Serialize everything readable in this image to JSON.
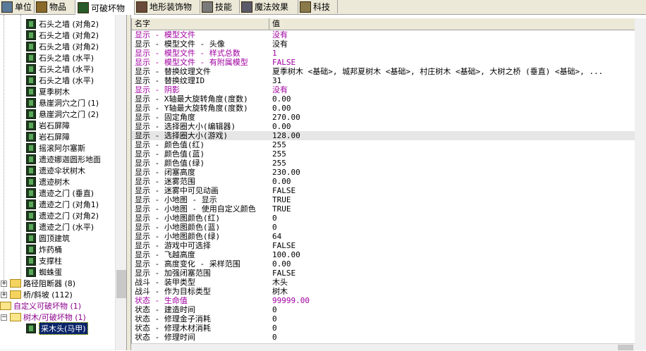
{
  "tabs": [
    {
      "label": "单位",
      "icon": "unit-icon",
      "active": false
    },
    {
      "label": "物品",
      "icon": "item-icon",
      "active": false
    },
    {
      "label": "可破坏物",
      "icon": "destructible-icon",
      "active": true
    },
    {
      "label": "地形装饰物",
      "icon": "doodad-icon",
      "active": false
    },
    {
      "label": "技能",
      "icon": "ability-icon",
      "active": false
    },
    {
      "label": "魔法效果",
      "icon": "buff-icon",
      "active": false
    },
    {
      "label": "科技",
      "icon": "upgrade-icon",
      "active": false
    }
  ],
  "tree": {
    "items": [
      {
        "label": "石头之墙 (对角2)"
      },
      {
        "label": "石头之墙 (对角2)"
      },
      {
        "label": "石头之墙 (对角2)"
      },
      {
        "label": "石头之墙 (水平)"
      },
      {
        "label": "石头之墙 (水平)"
      },
      {
        "label": "石头之墙 (水平)"
      },
      {
        "label": "夏季树木"
      },
      {
        "label": "悬崖洞穴之门 (1)"
      },
      {
        "label": "悬崖洞穴之门 (2)"
      },
      {
        "label": "岩石屏障"
      },
      {
        "label": "岩石屏障"
      },
      {
        "label": "摇滚阿尔塞斯"
      },
      {
        "label": "遗迹娜迦圆形地面"
      },
      {
        "label": "遗迹伞状树木"
      },
      {
        "label": "遗迹树木"
      },
      {
        "label": "遗迹之门 (垂直)"
      },
      {
        "label": "遗迹之门 (对角1)"
      },
      {
        "label": "遗迹之门 (对角2)"
      },
      {
        "label": "遗迹之门 (水平)"
      },
      {
        "label": "圆顶建筑"
      },
      {
        "label": "炸药桶"
      },
      {
        "label": "支撑柱"
      },
      {
        "label": "蜘蛛蛋"
      }
    ],
    "folders": [
      {
        "label": "路径阻断器 (8)"
      },
      {
        "label": "桥/斜坡 (112)"
      }
    ],
    "custom_root": "自定义可破坏物 (1)",
    "custom_sub": "树木/可破坏物 (1)",
    "selected_item": "采木头(马甲)",
    "expand_plus": "+",
    "expand_minus": "−"
  },
  "grid": {
    "col_name": "名字",
    "col_value": "值",
    "rows": [
      {
        "k": "显示 - 模型文件",
        "v": "没有",
        "purple": true
      },
      {
        "k": "显示 - 模型文件 - 头像",
        "v": "没有",
        "purple": false
      },
      {
        "k": "显示 - 模型文件 - 样式总数",
        "v": "1",
        "purple": true
      },
      {
        "k": "显示 - 模型文件 - 有附属模型",
        "v": "FALSE",
        "purple": true
      },
      {
        "k": "显示 - 替换纹理文件",
        "v": "夏季树木 <基础>, 城邦夏树木 <基础>, 村庄树木 <基础>, 大树之桥 (垂直) <基础>, ...",
        "purple": false
      },
      {
        "k": "显示 - 替换纹理ID",
        "v": "31",
        "purple": false
      },
      {
        "k": "显示 - 阴影",
        "v": "没有",
        "purple": true
      },
      {
        "k": "显示 - X轴最大旋转角度(度数)",
        "v": "0.00",
        "purple": false
      },
      {
        "k": "显示 - Y轴最大旋转角度(度数)",
        "v": "0.00",
        "purple": false
      },
      {
        "k": "显示 - 固定角度",
        "v": "270.00",
        "purple": false
      },
      {
        "k": "显示 - 选择圈大小(编辑器)",
        "v": "0.00",
        "purple": false
      },
      {
        "k": "显示 - 选择圈大小(游戏)",
        "v": "128.00",
        "purple": false,
        "hl": true
      },
      {
        "k": "显示 - 颜色值(红)",
        "v": "255",
        "purple": false
      },
      {
        "k": "显示 - 颜色值(蓝)",
        "v": "255",
        "purple": false
      },
      {
        "k": "显示 - 颜色值(绿)",
        "v": "255",
        "purple": false
      },
      {
        "k": "显示 - 闭塞高度",
        "v": "230.00",
        "purple": false
      },
      {
        "k": "显示 - 迷雾范围",
        "v": "0.00",
        "purple": false
      },
      {
        "k": "显示 - 迷雾中可见动画",
        "v": "FALSE",
        "purple": false
      },
      {
        "k": "显示 - 小地图 - 显示",
        "v": "TRUE",
        "purple": false
      },
      {
        "k": "显示 - 小地图 - 使用自定义颜色",
        "v": "TRUE",
        "purple": false
      },
      {
        "k": "显示 - 小地图颜色(红)",
        "v": "0",
        "purple": false
      },
      {
        "k": "显示 - 小地图颜色(蓝)",
        "v": "0",
        "purple": false
      },
      {
        "k": "显示 - 小地图颜色(绿)",
        "v": "64",
        "purple": false
      },
      {
        "k": "显示 - 游戏中可选择",
        "v": "FALSE",
        "purple": false
      },
      {
        "k": "显示 - 飞越高度",
        "v": "100.00",
        "purple": false
      },
      {
        "k": "显示 - 高度变化 - 采样范围",
        "v": "0.00",
        "purple": false
      },
      {
        "k": "显示 - 加强闭塞范围",
        "v": "FALSE",
        "purple": false
      },
      {
        "k": "战斗 - 装甲类型",
        "v": "木头",
        "purple": false
      },
      {
        "k": "战斗 - 作为目标类型",
        "v": "树木",
        "purple": false
      },
      {
        "k": "状态 - 生命值",
        "v": "99999.00",
        "purple": true
      },
      {
        "k": "状态 - 建造时间",
        "v": "0",
        "purple": false
      },
      {
        "k": "状态 - 修理金子消耗",
        "v": "0",
        "purple": false
      },
      {
        "k": "状态 - 修理木材消耗",
        "v": "0",
        "purple": false
      },
      {
        "k": "状态 - 修理时间",
        "v": "0",
        "purple": false
      }
    ]
  },
  "colors": {
    "modified_text": "#a000a0",
    "selection_bg": "#0a246a",
    "tab_bar_bg": "#ece9d8"
  }
}
